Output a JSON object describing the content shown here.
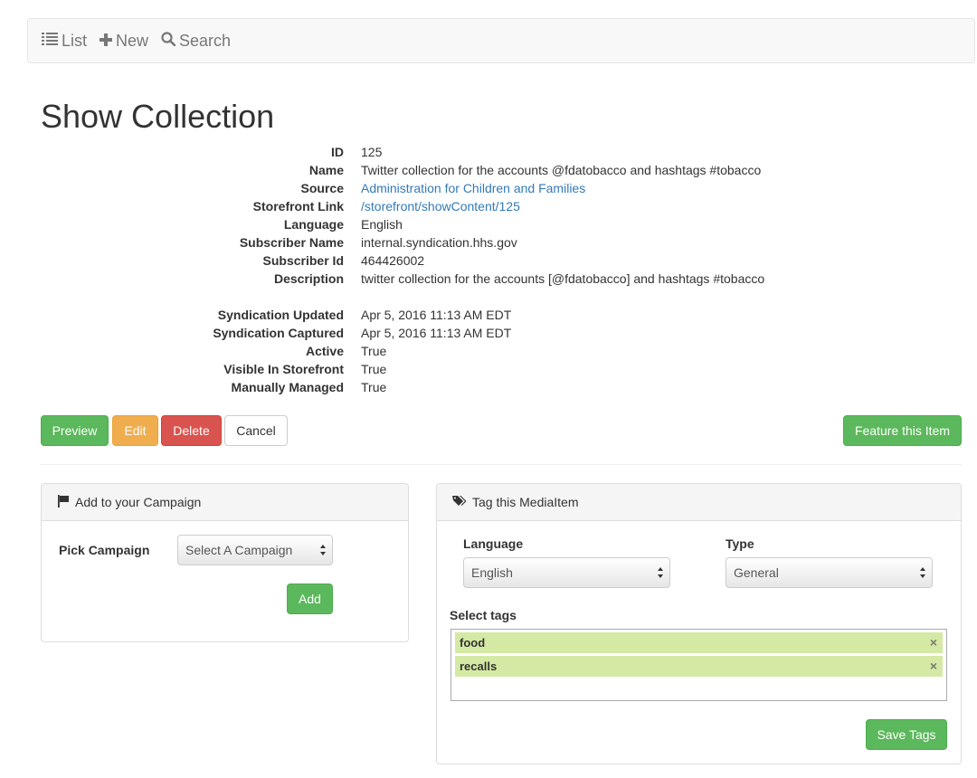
{
  "nav": {
    "list_label": "List",
    "new_label": "New",
    "search_label": "Search"
  },
  "page_title": "Show Collection",
  "details": [
    {
      "label": "ID",
      "value": "125"
    },
    {
      "label": "Name",
      "value": "Twitter collection for the accounts @fdatobacco and hashtags #tobacco"
    },
    {
      "label": "Source",
      "value": "Administration for Children and Families"
    },
    {
      "label": "Storefront Link",
      "value": "/storefront/showContent/125"
    },
    {
      "label": "Language",
      "value": "English"
    },
    {
      "label": "Subscriber Name",
      "value": "internal.syndication.hhs.gov"
    },
    {
      "label": "Subscriber Id",
      "value": "464426002"
    },
    {
      "label": "Description",
      "value": "twitter collection for the accounts [@fdatobacco] and hashtags #tobacco"
    },
    {
      "label": "Syndication Updated",
      "value": "Apr 5, 2016 11:13 AM EDT"
    },
    {
      "label": "Syndication Captured",
      "value": "Apr 5, 2016 11:13 AM EDT"
    },
    {
      "label": "Active",
      "value": "True"
    },
    {
      "label": "Visible In Storefront",
      "value": "True"
    },
    {
      "label": "Manually Managed",
      "value": "True"
    }
  ],
  "actions": {
    "preview": "Preview",
    "edit": "Edit",
    "delete": "Delete",
    "cancel": "Cancel",
    "feature": "Feature this Item"
  },
  "campaign_panel": {
    "title": "Add to your Campaign",
    "pick_label": "Pick Campaign",
    "select_value": "Select A Campaign",
    "add_button": "Add"
  },
  "tag_panel": {
    "title": "Tag this MediaItem",
    "language_label": "Language",
    "language_value": "English",
    "type_label": "Type",
    "type_value": "General",
    "select_tags_label": "Select tags",
    "tags": [
      "food",
      "recalls"
    ],
    "tag_remove_glyph": "×",
    "save_button": "Save Tags"
  },
  "colors": {
    "success": "#5cb85c",
    "warning": "#f0ad4e",
    "danger": "#d9534f",
    "link": "#337ab7",
    "tag_bg": "#d4eaa4"
  }
}
